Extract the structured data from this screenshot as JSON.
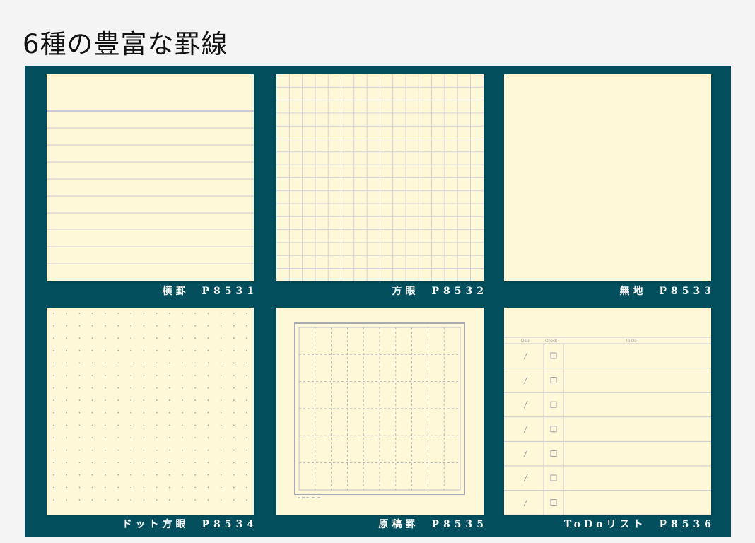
{
  "page": {
    "heading": "6種の豊富な罫線"
  },
  "products": [
    {
      "name": "横罫",
      "code": "P8531",
      "pattern": "ruled"
    },
    {
      "name": "方眼",
      "code": "P8532",
      "pattern": "grid"
    },
    {
      "name": "無地",
      "code": "P8533",
      "pattern": "plain"
    },
    {
      "name": "ドット方眼",
      "code": "P8534",
      "pattern": "dot-grid"
    },
    {
      "name": "原稿罫",
      "code": "P8535",
      "pattern": "manuscript"
    },
    {
      "name": "ToDoリスト",
      "code": "P8536",
      "pattern": "todo-list"
    }
  ],
  "todo_headers": {
    "date": "Date",
    "check": "Check",
    "todo": "To Do"
  },
  "colors": {
    "page_background": "#f4f4f4",
    "board_background": "#034f5d",
    "paper": "#fff8d8",
    "rule_line": "#c9c9cf",
    "caption_text": "#ffffff"
  }
}
